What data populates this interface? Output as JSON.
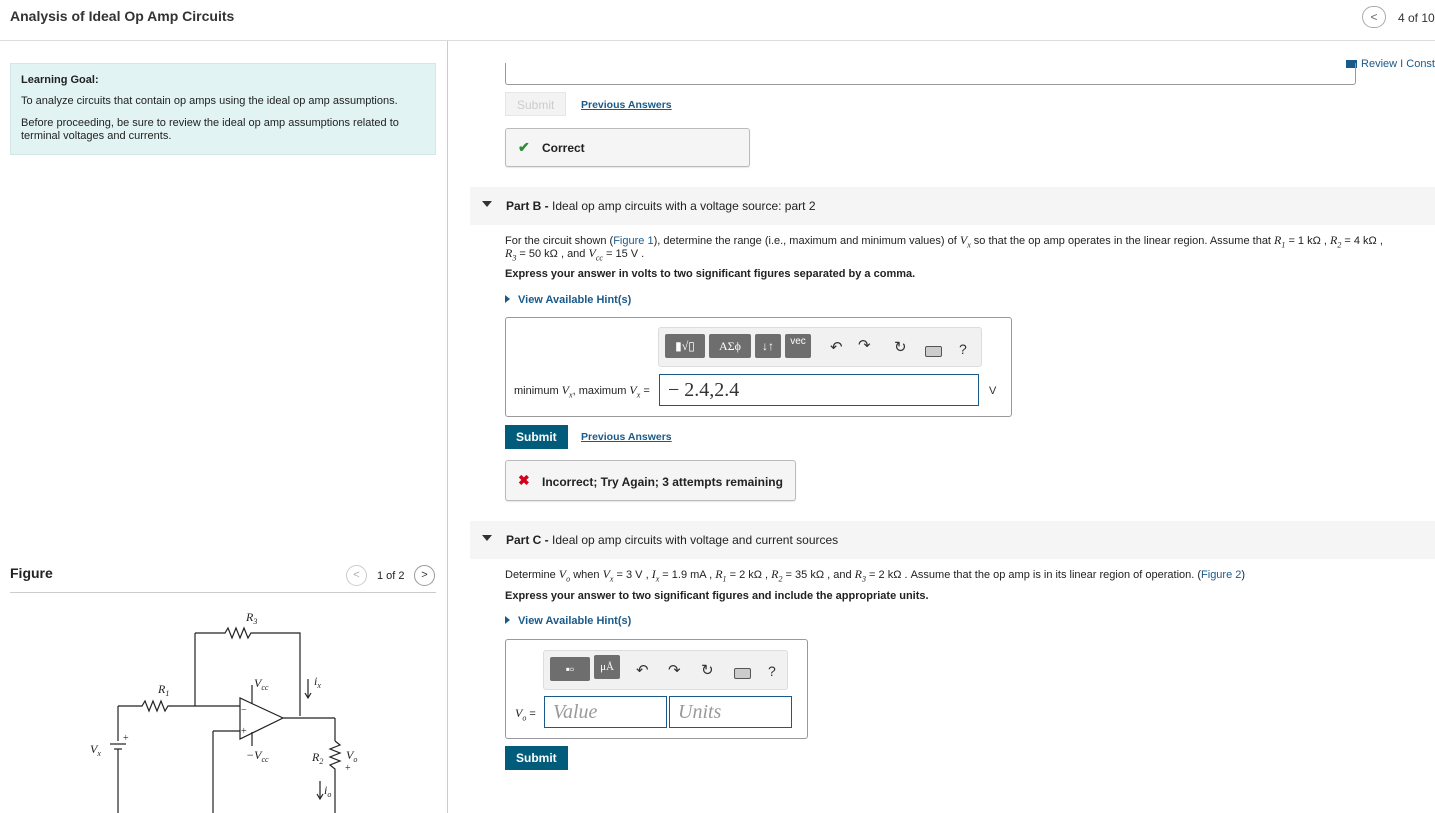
{
  "header": {
    "title": "Analysis of Ideal Op Amp Circuits",
    "prev_icon": "chevron-left-icon",
    "page_count": "4 of 10"
  },
  "learning_goal": {
    "title": "Learning Goal:",
    "line1": "To analyze circuits that contain op amps using the ideal op amp assumptions.",
    "line2a": "Before proceeding, be sure to review the ideal op amp assumptions related to",
    "line2b": "terminal voltages and currents."
  },
  "figure": {
    "title": "Figure",
    "count": "1 of 2",
    "labels": {
      "r3": "R",
      "r3_sub": "3",
      "r1": "R",
      "r1_sub": "1",
      "r2": "R",
      "r2_sub": "2",
      "vcc": "V",
      "vcc_sub": "cc",
      "neg_vcc": "−V",
      "neg_vcc_sub": "cc",
      "vx": "V",
      "vx_sub": "x",
      "vo": "V",
      "vo_sub": "o",
      "ix": "i",
      "ix_sub": "x",
      "io": "i",
      "io_sub": "o",
      "plus": "+",
      "minus": "−"
    }
  },
  "review": {
    "label": "Review I Const"
  },
  "part_a": {
    "submit": "Submit",
    "previous_answers": "Previous Answers",
    "feedback": "Correct"
  },
  "part_b": {
    "header_bold": "Part B -",
    "header_text": " Ideal op amp circuits with a voltage source: part 2",
    "prompt_1": "For the circuit shown (",
    "prompt_fig": "Figure 1",
    "prompt_2": "), determine the range (i.e., maximum and minimum values) of ",
    "prompt_3": " so that the op amp operates in the linear region. Assume that ",
    "prompt_r1": " = 1 kΩ , ",
    "prompt_r2": " = 4 kΩ ,",
    "prompt_line2a": " = 50 kΩ , and ",
    "prompt_line2b": " = 15 V .",
    "instruction": "Express your answer in volts to two significant figures separated by a comma.",
    "hint": "View Available Hint(s)",
    "answer_label_a": "minimum ",
    "answer_label_b": ", maximum ",
    "answer_label_c": " =",
    "answer_value": "− 2.4,2.4",
    "unit": "V",
    "submit": "Submit",
    "previous_answers": "Previous Answers",
    "feedback": "Incorrect; Try Again; 3 attempts remaining",
    "toolbar": {
      "templates": "▮√▯",
      "greek": "ΑΣϕ",
      "arrows": "↓↑",
      "vec": "vec",
      "help": "?"
    }
  },
  "part_c": {
    "header_bold": "Part C -",
    "header_text": " Ideal op amp circuits with voltage and current sources",
    "prompt_1": "Determine ",
    "prompt_2": " when ",
    "prompt_3": " = 3 V , ",
    "prompt_4": " = 1.9 mA , ",
    "prompt_5": " = 2 kΩ , ",
    "prompt_6": " = 35 kΩ , and ",
    "prompt_7": " = 2 kΩ . Assume that the op amp is in its linear region of operation. (",
    "prompt_fig": "Figure 2",
    "prompt_8": ")",
    "instruction": "Express your answer to two significant figures and include the appropriate units.",
    "hint": "View Available Hint(s)",
    "answer_label": " =",
    "value_placeholder": "Value",
    "units_placeholder": "Units",
    "submit": "Submit",
    "toolbar": {
      "units": "μÅ",
      "help": "?"
    }
  },
  "colors": {
    "accent": "#005c7a",
    "link": "#1a5a8a",
    "correct": "#2e8b3a",
    "incorrect": "#d0021b",
    "goal_bg": "#e2f3f3"
  }
}
